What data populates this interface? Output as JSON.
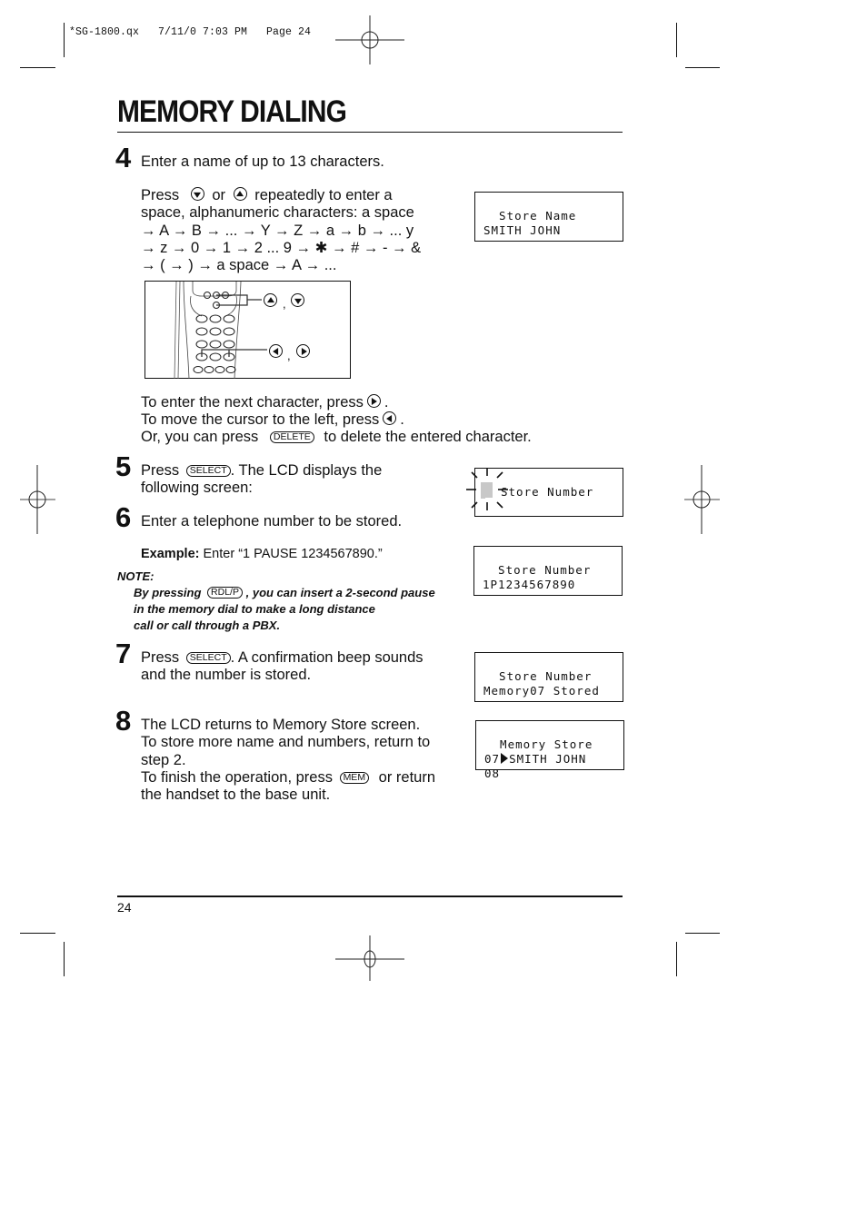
{
  "slug": "*SG-1800.qx   7/11/0 7:03 PM   Page 24",
  "title": "MEMORY DIALING",
  "page_number": "24",
  "steps": {
    "s4": {
      "number": "4",
      "heading": "Enter a name of up to 13 characters.",
      "press_word": "Press",
      "or_word": "or",
      "after_keys": "repeatedly to enter a",
      "lines": [
        "space, alphanumeric characters: a space",
        "→ A → B → ... → Y → Z → a → b → ... y",
        "→ z → 0 → 1 → 2 ... 9 → ✱ → # → - → &",
        "→ ( → ) → a space → A → ..."
      ],
      "next_char_text": "To enter the next character, press",
      "cursor_left_text": "To move the cursor to the left, press",
      "delete_pre": "Or, you can press",
      "delete_key": "DELETE",
      "delete_post": "to delete the entered character.",
      "illustration_comma": ",",
      "lcd": {
        "line1": "  Store Name",
        "line2": "SMITH JOHN"
      }
    },
    "s5": {
      "number": "5",
      "pre": "Press",
      "key": "SELECT",
      "post": ".  The LCD displays the",
      "line2": "following screen:",
      "lcd": {
        "line1": "Store Number"
      }
    },
    "s6": {
      "number": "6",
      "text": "Enter a telephone number to be stored.",
      "example_label": "Example:",
      "example_text": "Enter “1 PAUSE 1234567890.”",
      "note_head": "NOTE:",
      "note_pre": "By pressing",
      "note_key": "RDL/P",
      "note_post": ", you can insert a 2-second pause",
      "note_line2": "in the memory dial to make a long distance",
      "note_line3": "call or call through a PBX.",
      "lcd": {
        "line1": "  Store Number",
        "line2": "1P1234567890"
      }
    },
    "s7": {
      "number": "7",
      "pre": "Press",
      "key": "SELECT",
      "post": ".  A confirmation beep sounds",
      "line2": "and the number is stored.",
      "lcd": {
        "line1": "  Store Number",
        "line2": "Memory07 Stored"
      }
    },
    "s8": {
      "number": "8",
      "line1": "The LCD returns to Memory Store screen.",
      "line2": "To store more name and numbers, return to",
      "line3": "step 2.",
      "finish_pre": "To finish the operation, press",
      "finish_key": "MEM",
      "finish_post": "or return",
      "line5": "the handset to the base unit.",
      "lcd": {
        "line1": "  Memory Store",
        "line2_num": "07",
        "line2_name": "SMITH JOHN",
        "line3": "08"
      }
    }
  }
}
